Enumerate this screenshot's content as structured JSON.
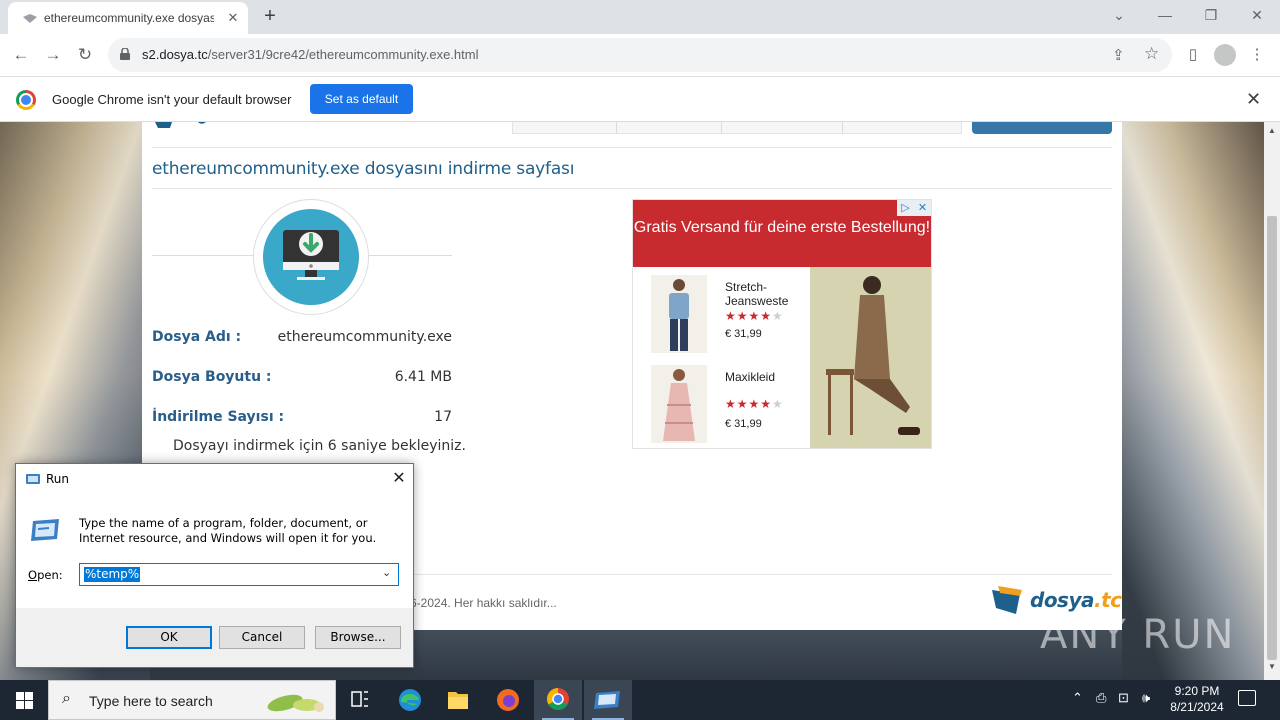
{
  "browser": {
    "tab_title": "ethereumcommunity.exe dosyası",
    "new_tab": "+",
    "url_host": "s2.dosya.tc",
    "url_path": "/server31/9cre42/ethereumcommunity.exe.html",
    "infobar_message": "Google Chrome isn't your default browser",
    "infobar_button": "Set as default"
  },
  "page": {
    "heading": "ethereumcommunity.exe dosyasını indirme sayfası",
    "file_name_label": "Dosya Adı :",
    "file_name_value": "ethereumcommunity.exe",
    "file_size_label": "Dosya Boyutu :",
    "file_size_value": "6.41 MB",
    "download_count_label": "İndirilme Sayısı :",
    "download_count_value": "17",
    "wait_message": "Dosyayı indirmek için 6 saniye bekleyiniz.",
    "copyright": "6-2024. Her hakkı saklıdır...",
    "footer_logo_main": "dosya",
    "footer_logo_ext": ".tc"
  },
  "ad": {
    "banner": "Gratis Versand für deine erste Bestellung!",
    "products": [
      {
        "name": "Stretch-Jeansweste",
        "rating": 4,
        "max_rating": 5,
        "price": "€ 31,99"
      },
      {
        "name": "Maxikleid",
        "rating": 4,
        "max_rating": 5,
        "price": "€ 31,99"
      }
    ]
  },
  "run_dialog": {
    "title": "Run",
    "description": "Type the name of a program, folder, document, or Internet resource, and Windows will open it for you.",
    "open_label_underlined": "O",
    "open_label_rest": "pen:",
    "open_value": "%temp%",
    "ok": "OK",
    "cancel": "Cancel",
    "browse": "Browse..."
  },
  "taskbar": {
    "search_placeholder": "Type here to search",
    "time": "9:20 PM",
    "date": "8/21/2024"
  },
  "watermark": "ANY RUN",
  "colors": {
    "accent_blue": "#1a73e8",
    "page_heading": "#1f5f8b",
    "ad_red": "#c72a2f",
    "selection": "#0078d7"
  }
}
